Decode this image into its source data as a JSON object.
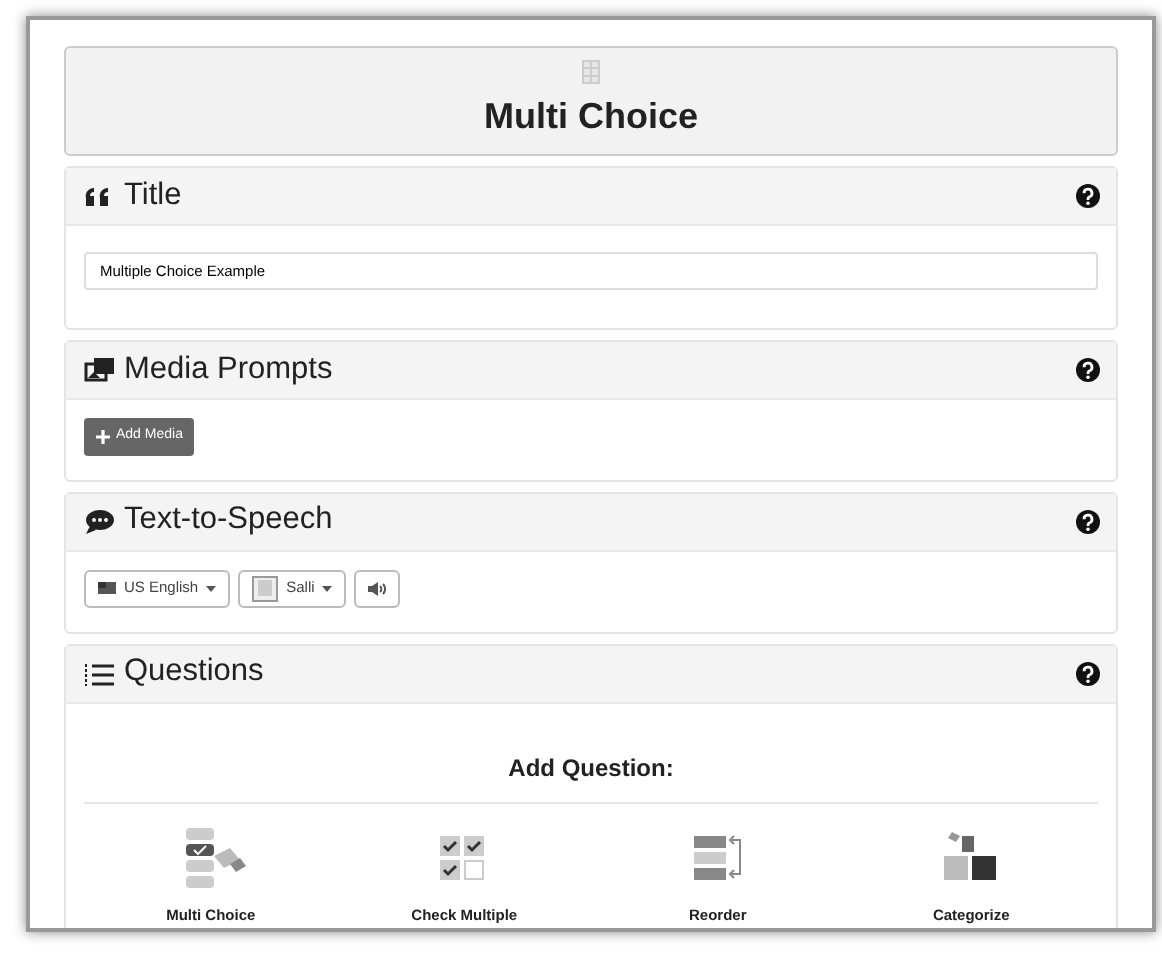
{
  "header": {
    "title": "Multi Choice"
  },
  "sections": [
    {
      "kind": "title",
      "title": "Title",
      "value": "Multiple Choice Example"
    },
    {
      "kind": "media",
      "title": "Media Prompts",
      "button": "Add Media"
    },
    {
      "kind": "speech",
      "title": "Text-to-Speech",
      "language": "US English",
      "voice": "Salli"
    },
    {
      "kind": "questions",
      "title": "Questions",
      "heading": "Add Question:",
      "types": [
        {
          "kind": "multi",
          "label": "Multi Choice"
        },
        {
          "kind": "check",
          "label": "Check Multiple"
        },
        {
          "kind": "reorder",
          "label": "Reorder"
        },
        {
          "kind": "categorize",
          "label": "Categorize"
        }
      ]
    }
  ]
}
